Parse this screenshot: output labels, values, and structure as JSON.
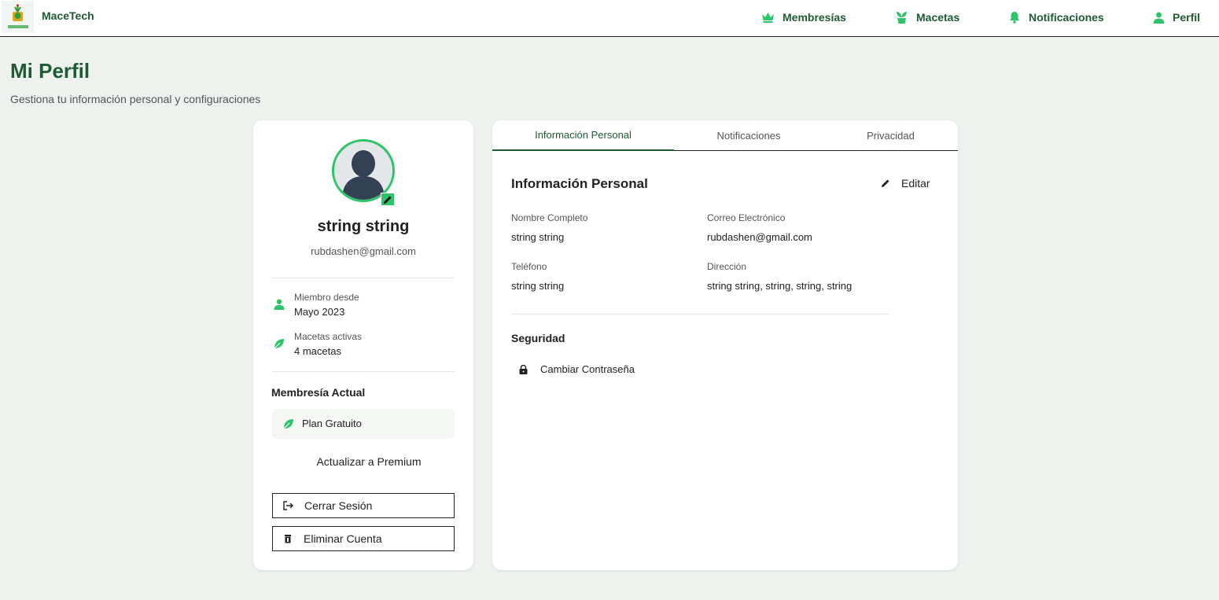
{
  "app": {
    "brand": "MaceTech"
  },
  "nav": {
    "memberships": "Membresías",
    "pots": "Macetas",
    "notifications": "Notificaciones",
    "profile": "Perfil"
  },
  "page": {
    "title": "Mi Perfil",
    "subtitle": "Gestiona tu información personal y configuraciones"
  },
  "profile_card": {
    "name": "string string",
    "email": "rubdashen@gmail.com",
    "member_since_label": "Miembro desde",
    "member_since_value": "Mayo 2023",
    "active_pots_label": "Macetas activas",
    "active_pots_value": "4 macetas",
    "membership_heading": "Membresía Actual",
    "plan_name": "Plan Gratuito",
    "upgrade_label": "Actualizar a Premium",
    "logout_label": "Cerrar Sesión",
    "delete_label": "Eliminar Cuenta"
  },
  "tabs": [
    "Información Personal",
    "Notificaciones",
    "Privacidad"
  ],
  "personal_info": {
    "title": "Información Personal",
    "edit_label": "Editar",
    "full_name_label": "Nombre Completo",
    "full_name_value": "string string",
    "email_label": "Correo Electrónico",
    "email_value": "rubdashen@gmail.com",
    "phone_label": "Teléfono",
    "phone_value": "string string",
    "address_label": "Dirección",
    "address_value": "string string, string, string, string"
  },
  "security": {
    "title": "Seguridad",
    "change_password_label": "Cambiar Contraseña"
  },
  "colors": {
    "brand_green": "#1f5a33",
    "accent_green": "#2ec56a",
    "background": "#edf2ee"
  }
}
